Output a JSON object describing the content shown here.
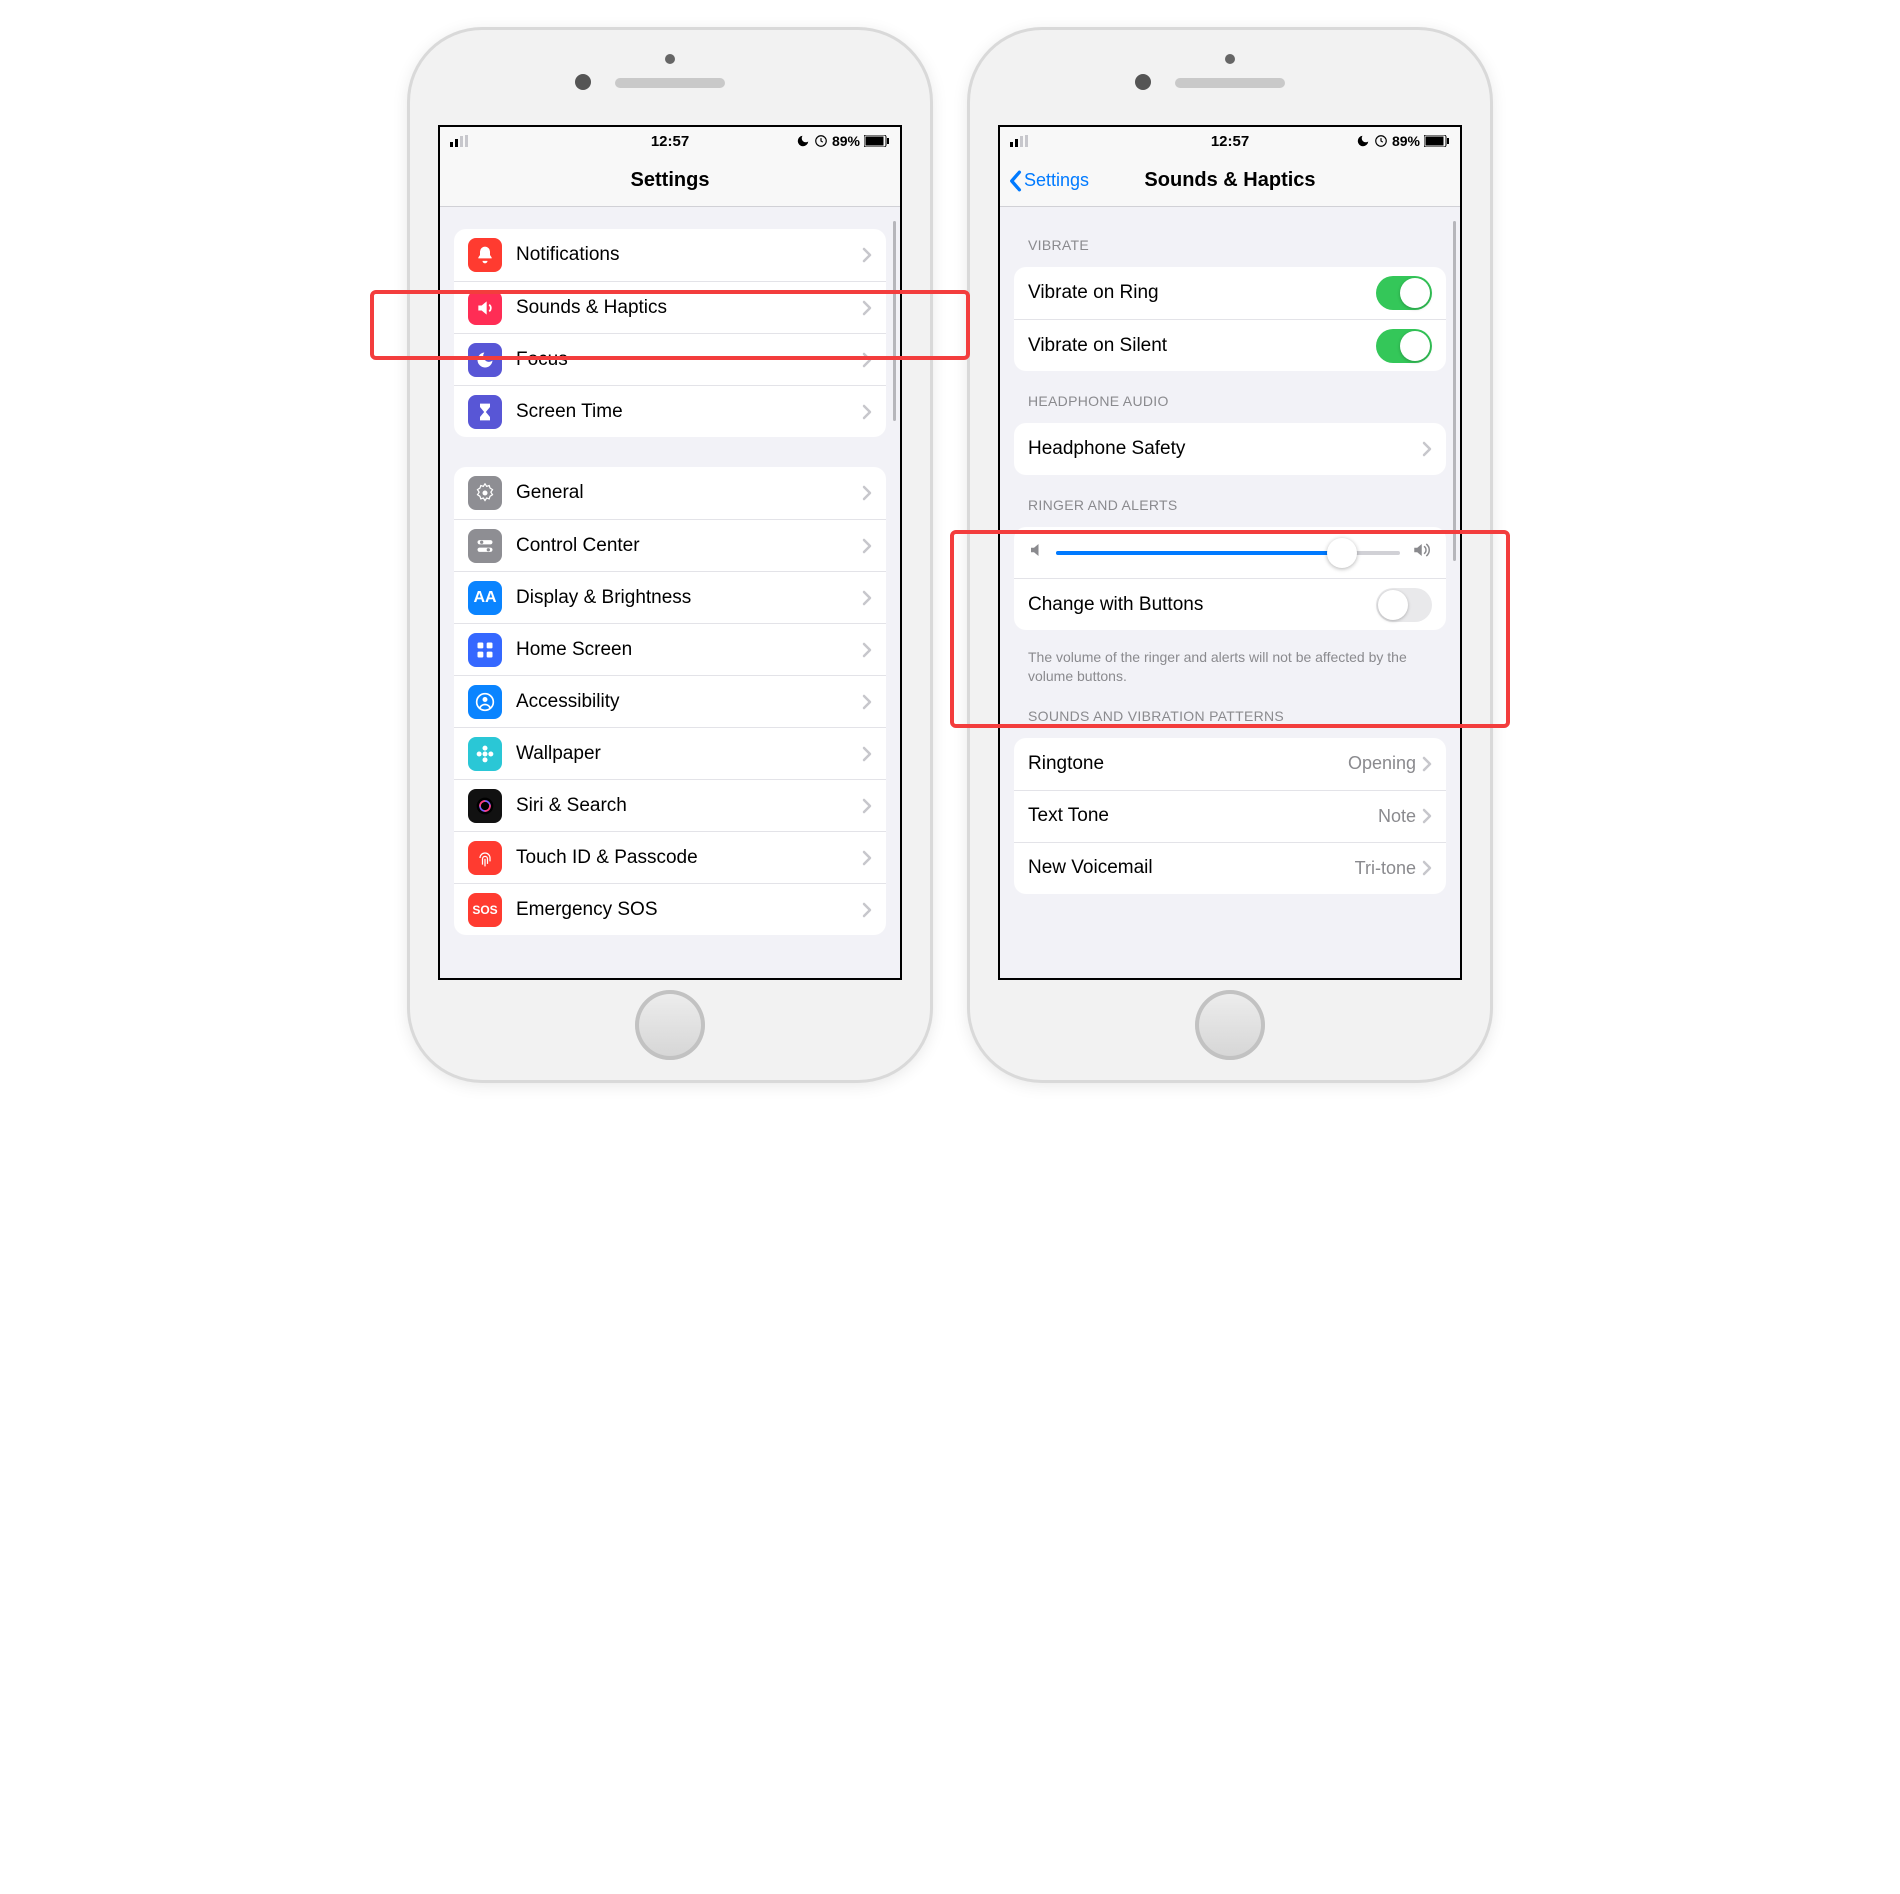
{
  "status": {
    "time": "12:57",
    "battery": "89%"
  },
  "left": {
    "title": "Settings",
    "group1": [
      {
        "id": "notifications",
        "label": "Notifications",
        "iconBg": "#ff3b30",
        "icon": "bell"
      },
      {
        "id": "sounds",
        "label": "Sounds & Haptics",
        "iconBg": "#ff2d55",
        "icon": "speaker"
      },
      {
        "id": "focus",
        "label": "Focus",
        "iconBg": "#5856d6",
        "icon": "moon"
      },
      {
        "id": "screentime",
        "label": "Screen Time",
        "iconBg": "#5856d6",
        "icon": "hourglass"
      }
    ],
    "group2": [
      {
        "id": "general",
        "label": "General",
        "iconBg": "#8e8e93",
        "icon": "gear"
      },
      {
        "id": "controlcenter",
        "label": "Control Center",
        "iconBg": "#8e8e93",
        "icon": "switches"
      },
      {
        "id": "display",
        "label": "Display & Brightness",
        "iconBg": "#0a84ff",
        "icon": "AA"
      },
      {
        "id": "homescreen",
        "label": "Home Screen",
        "iconBg": "#3568ff",
        "icon": "grid"
      },
      {
        "id": "accessibility",
        "label": "Accessibility",
        "iconBg": "#0a84ff",
        "icon": "person"
      },
      {
        "id": "wallpaper",
        "label": "Wallpaper",
        "iconBg": "#2ac7d6",
        "icon": "flower"
      },
      {
        "id": "siri",
        "label": "Siri & Search",
        "iconBg": "#111",
        "icon": "siri"
      },
      {
        "id": "touchid",
        "label": "Touch ID & Passcode",
        "iconBg": "#ff3b30",
        "icon": "fingerprint"
      },
      {
        "id": "sos",
        "label": "Emergency SOS",
        "iconBg": "#ff3b30",
        "icon": "sos"
      }
    ]
  },
  "right": {
    "back": "Settings",
    "title": "Sounds & Haptics",
    "sectionVibrate": {
      "header": "Vibrate",
      "rows": [
        {
          "id": "vibrate-ring",
          "label": "Vibrate on Ring",
          "on": true
        },
        {
          "id": "vibrate-silent",
          "label": "Vibrate on Silent",
          "on": true
        }
      ]
    },
    "sectionHeadphone": {
      "header": "Headphone Audio",
      "rows": [
        {
          "id": "headphone-safety",
          "label": "Headphone Safety"
        }
      ]
    },
    "sectionRinger": {
      "header": "Ringer and Alerts",
      "sliderPercent": 83,
      "changeLabel": "Change with Buttons",
      "changeOn": false,
      "footer": "The volume of the ringer and alerts will not be affected by the volume buttons."
    },
    "sectionPatterns": {
      "header": "Sounds and Vibration Patterns",
      "rows": [
        {
          "id": "ringtone",
          "label": "Ringtone",
          "value": "Opening"
        },
        {
          "id": "texttone",
          "label": "Text Tone",
          "value": "Note"
        },
        {
          "id": "voicemail",
          "label": "New Voicemail",
          "value": "Tri-tone"
        }
      ]
    }
  }
}
